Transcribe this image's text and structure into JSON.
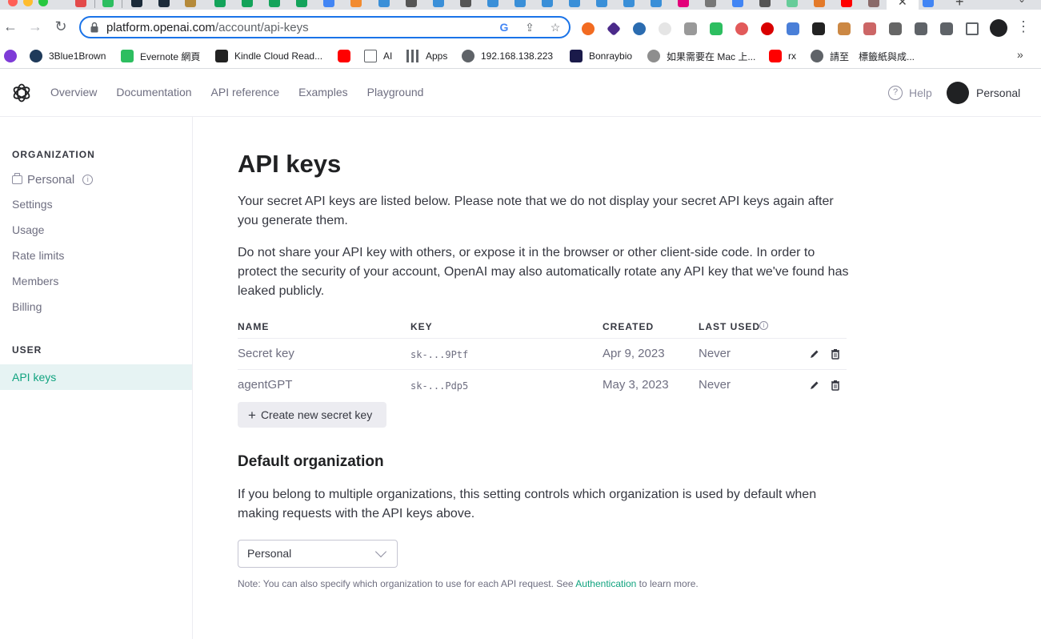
{
  "browser": {
    "url_host": "platform.openai.com",
    "url_path": "/account/api-keys",
    "bookmarks": [
      {
        "label": "",
        "color": "#7e3bd7"
      },
      {
        "label": "3Blue1Brown",
        "color": "#1f3a5a"
      },
      {
        "label": "Evernote 網頁",
        "color": "#2dbe60"
      },
      {
        "label": "Kindle Cloud Read...",
        "color": "#222222"
      },
      {
        "label": "",
        "color": "#ff0000"
      },
      {
        "label": "AI",
        "color": "#5f6368"
      },
      {
        "label": "Apps",
        "color": "#5f6368"
      },
      {
        "label": "192.168.138.223",
        "color": "#5f6368"
      },
      {
        "label": "Bonraybio",
        "color": "#1a1a4a"
      },
      {
        "label": "如果需要在 Mac 上...",
        "color": "#8e8e8e"
      },
      {
        "label": "rx",
        "color": "#ff0000"
      },
      {
        "label": "請至",
        "color": "#5f6368"
      },
      {
        "label": "標籤紙與成...",
        "color": "#ffffff"
      }
    ]
  },
  "header": {
    "nav": [
      "Overview",
      "Documentation",
      "API reference",
      "Examples",
      "Playground"
    ],
    "help": "Help",
    "account": "Personal"
  },
  "sidebar": {
    "org_heading": "ORGANIZATION",
    "org_name": "Personal",
    "org_items": [
      "Settings",
      "Usage",
      "Rate limits",
      "Members",
      "Billing"
    ],
    "user_heading": "USER",
    "user_active": "API keys"
  },
  "main": {
    "title": "API keys",
    "para1": "Your secret API keys are listed below. Please note that we do not display your secret API keys again after you generate them.",
    "para2": "Do not share your API key with others, or expose it in the browser or other client-side code. In order to protect the security of your account, OpenAI may also automatically rotate any API key that we've found has leaked publicly.",
    "table": {
      "headers": [
        "NAME",
        "KEY",
        "CREATED",
        "LAST USED"
      ],
      "rows": [
        {
          "name": "Secret key",
          "key": "sk-...9Ptf",
          "created": "Apr 9, 2023",
          "last_used": "Never"
        },
        {
          "name": "agentGPT",
          "key": "sk-...Pdp5",
          "created": "May 3, 2023",
          "last_used": "Never"
        }
      ]
    },
    "create_button": "Create new secret key",
    "default_org_title": "Default organization",
    "default_org_para": "If you belong to multiple organizations, this setting controls which organization is used by default when making requests with the API keys above.",
    "select_value": "Personal",
    "note_prefix": "Note: You can also specify which organization to use for each API request. See ",
    "note_link": "Authentication",
    "note_suffix": " to learn more."
  },
  "colors": {
    "accent": "#10a37f",
    "active_bg": "#e6f3f3",
    "omnibox_border": "#1a73e8"
  }
}
